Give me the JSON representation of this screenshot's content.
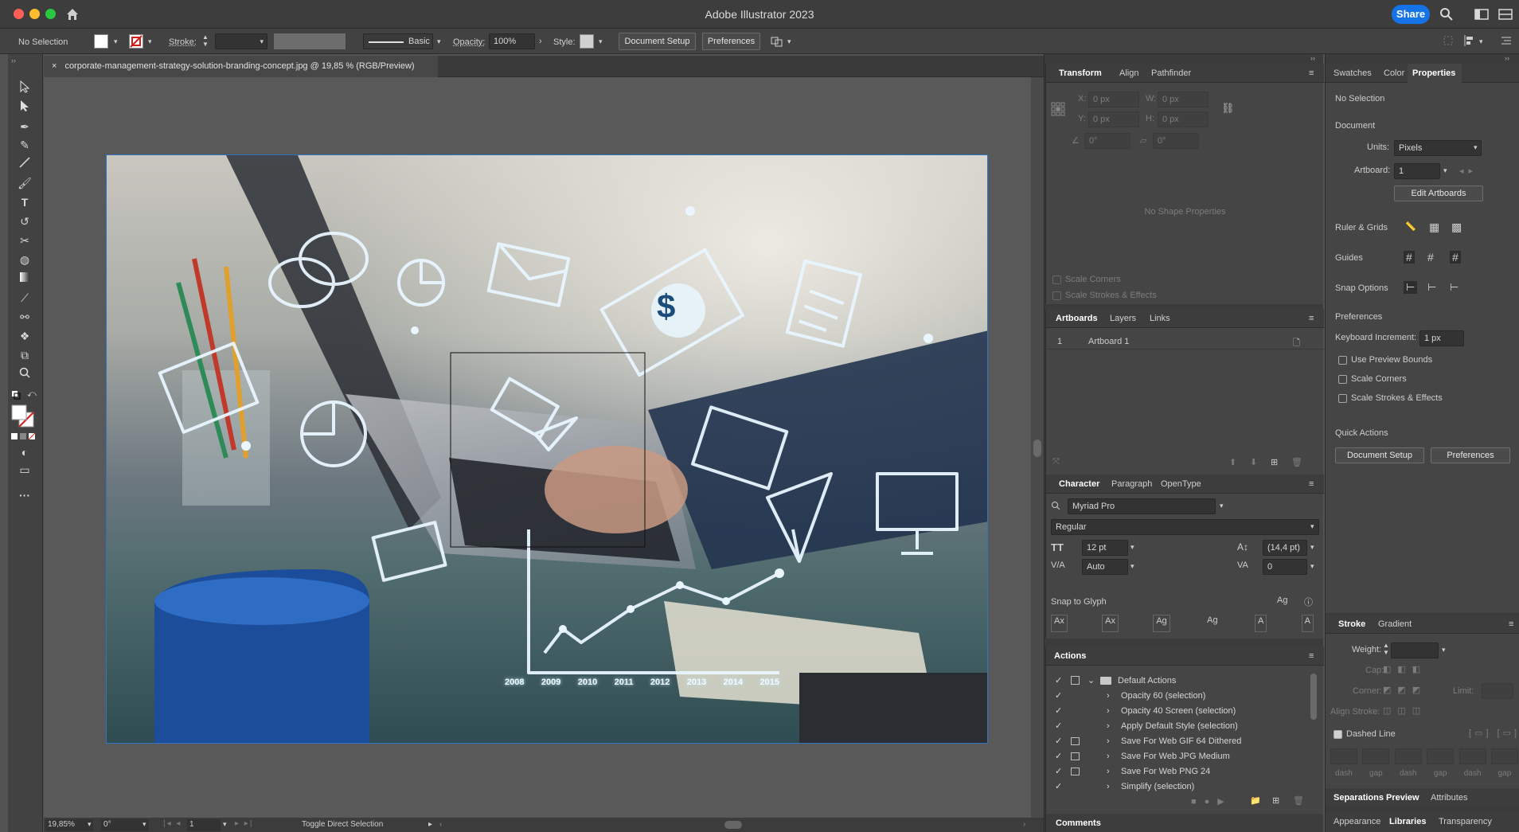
{
  "app": {
    "title": "Adobe Illustrator 2023",
    "share_label": "Share"
  },
  "control_bar": {
    "selection": "No Selection",
    "stroke_label": "Stroke:",
    "brush_label": "Basic",
    "opacity_label": "Opacity:",
    "opacity_value": "100%",
    "style_label": "Style:",
    "document_setup": "Document Setup",
    "preferences": "Preferences"
  },
  "document": {
    "tab_title": "corporate-management-strategy-solution-branding-concept.jpg @ 19,85 % (RGB/Preview)",
    "close_glyph": "×"
  },
  "artwork": {
    "chart_years": [
      "2008",
      "2009",
      "2010",
      "2011",
      "2012",
      "2013",
      "2014",
      "2015"
    ],
    "dollar_sign": "$"
  },
  "status": {
    "zoom": "19,85%",
    "rotation": "0°",
    "artboard": "1",
    "tool_hint": "Toggle Direct Selection"
  },
  "transform_panel": {
    "tabs": [
      "Transform",
      "Align",
      "Pathfinder"
    ],
    "x_label": "X:",
    "x_value": "0 px",
    "y_label": "Y:",
    "y_value": "0 px",
    "w_label": "W:",
    "w_value": "0 px",
    "h_label": "H:",
    "h_value": "0 px",
    "angle_value": "0°",
    "shear_value": "0°",
    "empty_text": "No Shape Properties",
    "scale_corners": "Scale Corners",
    "scale_strokes": "Scale Strokes & Effects"
  },
  "artboards_panel": {
    "tabs": [
      "Artboards",
      "Layers",
      "Links"
    ],
    "row_index": "1",
    "row_name": "Artboard 1"
  },
  "character_panel": {
    "tabs": [
      "Character",
      "Paragraph",
      "OpenType"
    ],
    "font_family": "Myriad Pro",
    "font_style": "Regular",
    "font_size": "12 pt",
    "leading": "(14,4 pt)",
    "kerning": "Auto",
    "tracking": "0",
    "snap_to_glyph": "Snap to Glyph"
  },
  "actions_panel": {
    "title": "Actions",
    "set_name": "Default Actions",
    "items": [
      "Opacity 60 (selection)",
      "Opacity 40 Screen (selection)",
      "Apply Default Style (selection)",
      "Save For Web GIF 64 Dithered",
      "Save For Web JPG Medium",
      "Save For Web PNG 24",
      "Simplify (selection)"
    ]
  },
  "comments_tab": "Comments",
  "properties_panel": {
    "tabs": [
      "Swatches",
      "Color",
      "Properties"
    ],
    "selection": "No Selection",
    "document_heading": "Document",
    "units_label": "Units:",
    "units_value": "Pixels",
    "artboard_label": "Artboard:",
    "artboard_value": "1",
    "edit_artboards": "Edit Artboards",
    "ruler_grids": "Ruler & Grids",
    "guides": "Guides",
    "snap_options": "Snap Options",
    "preferences_heading": "Preferences",
    "keyboard_increment_label": "Keyboard Increment:",
    "keyboard_increment_value": "1 px",
    "use_preview_bounds": "Use Preview Bounds",
    "scale_corners": "Scale Corners",
    "scale_strokes": "Scale Strokes & Effects",
    "quick_actions": "Quick Actions",
    "document_setup": "Document Setup",
    "preferences": "Preferences"
  },
  "stroke_panel": {
    "tabs": [
      "Stroke",
      "Gradient"
    ],
    "weight_label": "Weight:",
    "cap_label": "Cap:",
    "corner_label": "Corner:",
    "limit_label": "Limit:",
    "align_stroke_label": "Align Stroke:",
    "dashed_line": "Dashed Line",
    "dash_labels": [
      "dash",
      "gap",
      "dash",
      "gap",
      "dash",
      "gap"
    ]
  },
  "bottom_tabs": {
    "separations": "Separations Preview",
    "attributes": "Attributes",
    "appearance": "Appearance",
    "libraries": "Libraries",
    "transparency": "Transparency"
  },
  "colors": {
    "accent": "#1473e6",
    "panel_bg": "#454545",
    "canvas_bg": "#595959",
    "artboard_border": "#2f73c6"
  }
}
